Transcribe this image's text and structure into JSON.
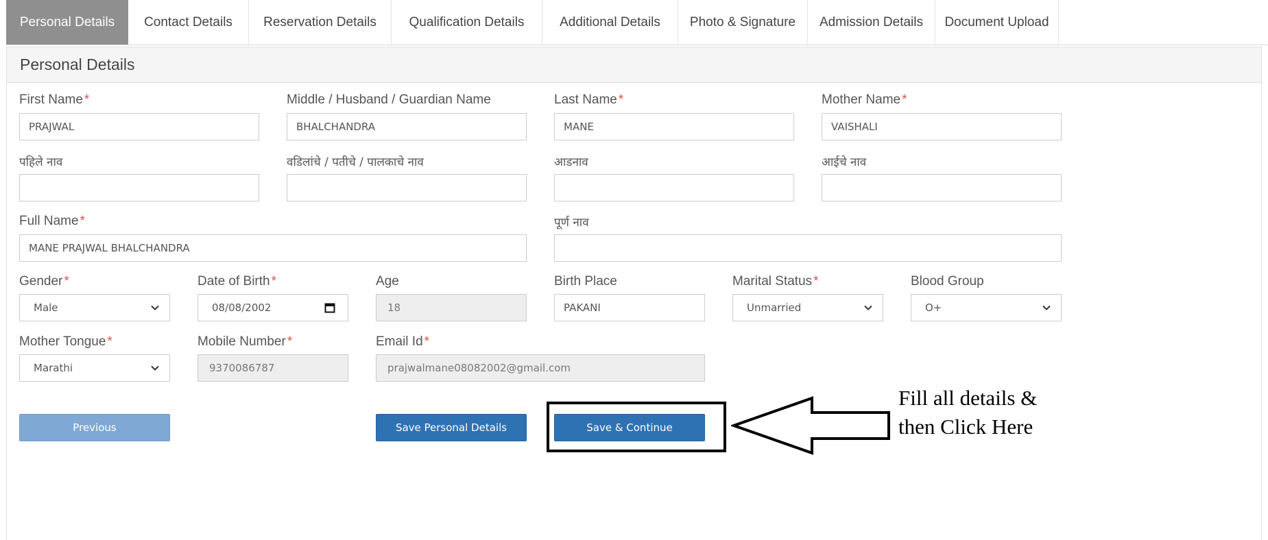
{
  "tabs": [
    {
      "label": "Personal Details",
      "active": true
    },
    {
      "label": "Contact Details"
    },
    {
      "label": "Reservation Details"
    },
    {
      "label": "Qualification Details"
    },
    {
      "label": "Additional Details"
    },
    {
      "label": "Photo & Signature"
    },
    {
      "label": "Admission Details"
    },
    {
      "label": "Document Upload"
    }
  ],
  "panel": {
    "title": "Personal Details"
  },
  "labels": {
    "first_name": "First Name",
    "middle_name": "Middle / Husband / Guardian Name",
    "last_name": "Last Name",
    "mother_name": "Mother Name",
    "first_name_mr": "पहिले नाव",
    "middle_name_mr": "वडिलांचे / पतीचे / पालकाचे नाव",
    "last_name_mr": "आडनाव",
    "mother_name_mr": "आईचे नाव",
    "full_name": "Full Name",
    "full_name_mr": "पूर्ण नाव",
    "gender": "Gender",
    "dob": "Date of Birth",
    "age": "Age",
    "birth_place": "Birth Place",
    "marital_status": "Marital Status",
    "blood_group": "Blood Group",
    "mother_tongue": "Mother Tongue",
    "mobile": "Mobile Number",
    "email": "Email Id",
    "required_mark": "*"
  },
  "values": {
    "first_name": "PRAJWAL",
    "middle_name": "BHALCHANDRA",
    "last_name": "MANE",
    "mother_name": "VAISHALI",
    "first_name_mr": "",
    "middle_name_mr": "",
    "last_name_mr": "",
    "mother_name_mr": "",
    "full_name": "MANE PRAJWAL BHALCHANDRA",
    "full_name_mr": "",
    "gender": "Male",
    "dob": "08/08/2002",
    "age": "18",
    "birth_place": "PAKANI",
    "marital_status": "Unmarried",
    "blood_group": "O+",
    "mother_tongue": "Marathi",
    "mobile": "9370086787",
    "email": "prajwalmane08082002@gmail.com"
  },
  "buttons": {
    "previous": "Previous",
    "save_personal": "Save Personal Details",
    "save_continue": "Save & Continue"
  },
  "annotation": {
    "line1": "Fill all details &",
    "line2": "then Click Here"
  },
  "colors": {
    "active_tab": "#8f8f8f",
    "primary_button": "#2f72b3",
    "previous_button": "#7fa9d4",
    "required": "#d9534f"
  },
  "icons": {
    "dropdown": "chevron-down-icon",
    "calendar": "calendar-icon",
    "arrow": "left-arrow-icon"
  }
}
